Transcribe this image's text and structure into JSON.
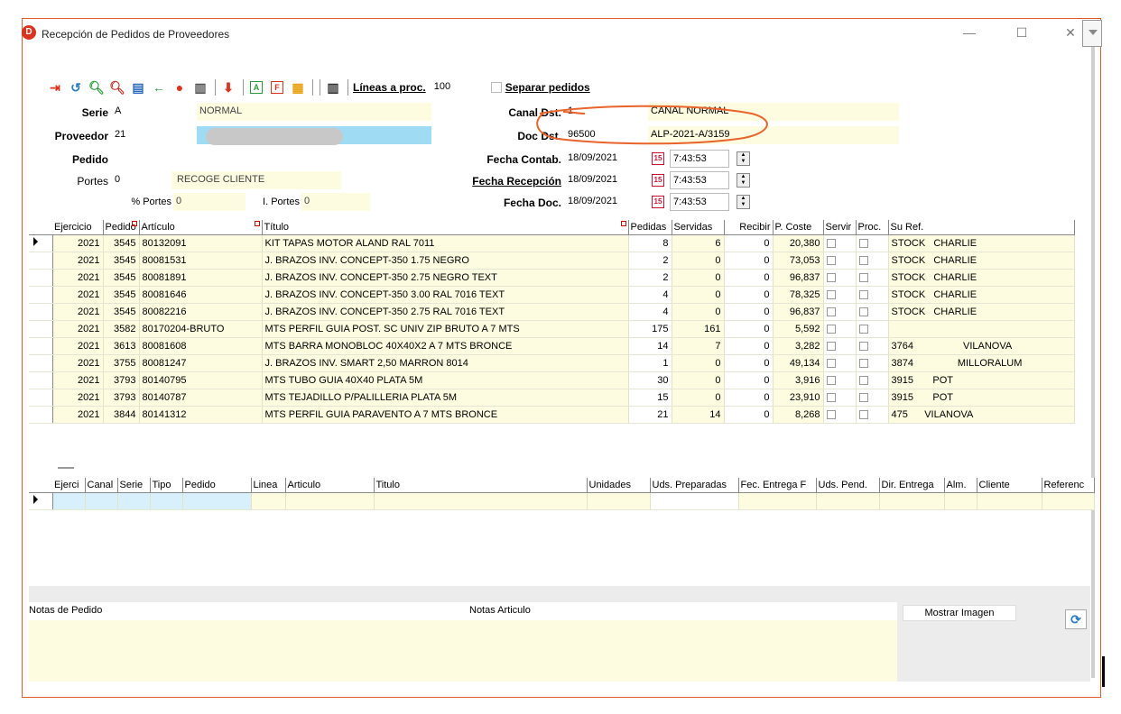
{
  "window": {
    "title": "Recepción de Pedidos de Proveedores",
    "icon_letter": "D",
    "controls": [
      "—",
      "☐",
      "✕"
    ]
  },
  "toolbar": {
    "icons": [
      "exit-icon",
      "undo-icon",
      "search-icon",
      "search-alt-icon",
      "grid-icon",
      "back-arrow-icon",
      "alert-icon",
      "clipboard-icon",
      "download-icon",
      "a-box-icon",
      "f-box-icon",
      "table-icon",
      "columns-icon"
    ],
    "lineas_label": "Líneas a proc.",
    "lineas_value": "100",
    "separar_label": "Separar pedidos"
  },
  "header_fields": {
    "serie_label": "Serie",
    "serie_value": "A",
    "serie_desc": "NORMAL",
    "proveedor_label": "Proveedor",
    "proveedor_value": "21",
    "pedido_label": "Pedido",
    "pedido_value": "",
    "portes_label": "Portes",
    "portes_value": "0",
    "portes_desc": "RECOGE CLIENTE",
    "pct_portes_label": "% Portes",
    "pct_portes_value": "0",
    "i_portes_label": "I. Portes",
    "i_portes_value": "0",
    "canal_label": "Canal Dst.",
    "canal_value": "1",
    "canal_desc": "CANAL NORMAL",
    "doc_label": "Doc Dst.",
    "doc_value": "96500",
    "doc_desc": "ALP-2021-A/3159",
    "fecha_contab_label": "Fecha Contab.",
    "fecha_contab_date": "18/09/2021",
    "fecha_contab_time": "7:43:53",
    "fecha_recep_label": "Fecha Recepción",
    "fecha_recep_date": "18/09/2021",
    "fecha_recep_time": "7:43:53",
    "fecha_doc_label": "Fecha Doc.",
    "fecha_doc_date": "18/09/2021",
    "fecha_doc_time": "7:43:53",
    "cal_glyph": "15"
  },
  "lines_table": {
    "columns": [
      "Ejercicio",
      "Pedido",
      "Artículo",
      "Título",
      "Pedidas",
      "Servidas",
      "Recibir",
      "P. Coste",
      "Servir",
      "Proc.",
      "Su Ref."
    ],
    "rows": [
      [
        "2021",
        "3545",
        "80132091",
        "KIT TAPAS MOTOR ALAND RAL 7011",
        "8",
        "6",
        "0",
        "20,380",
        "STOCK   CHARLIE"
      ],
      [
        "2021",
        "3545",
        "80081531",
        "J. BRAZOS INV. CONCEPT-350 1.75 NEGRO",
        "2",
        "0",
        "0",
        "73,053",
        "STOCK   CHARLIE"
      ],
      [
        "2021",
        "3545",
        "80081891",
        "J. BRAZOS INV. CONCEPT-350 2.75 NEGRO TEXT",
        "2",
        "0",
        "0",
        "96,837",
        "STOCK   CHARLIE"
      ],
      [
        "2021",
        "3545",
        "80081646",
        "J. BRAZOS INV. CONCEPT-350 3.00 RAL 7016 TEXT",
        "4",
        "0",
        "0",
        "78,325",
        "STOCK   CHARLIE"
      ],
      [
        "2021",
        "3545",
        "80082216",
        "J. BRAZOS INV. CONCEPT-350 2.75 RAL 7016 TEXT",
        "4",
        "0",
        "0",
        "96,837",
        "STOCK   CHARLIE"
      ],
      [
        "2021",
        "3582",
        "80170204-BRUTO",
        "MTS PERFIL GUIA POST. SC UNIV ZIP BRUTO A 7 MTS",
        "175",
        "161",
        "0",
        "5,592",
        ""
      ],
      [
        "2021",
        "3613",
        "80081608",
        "MTS BARRA MONOBLOC 40X40X2 A 7 MTS BRONCE",
        "14",
        "7",
        "0",
        "3,282",
        "3764                  VILANOVA"
      ],
      [
        "2021",
        "3755",
        "80081247",
        "J. BRAZOS INV. SMART 2,50 MARRON 8014",
        "1",
        "0",
        "0",
        "49,134",
        "3874                MILLORALUM"
      ],
      [
        "2021",
        "3793",
        "80140795",
        "MTS TUBO GUIA 40X40 PLATA 5M",
        "30",
        "0",
        "0",
        "3,916",
        "3915       POT"
      ],
      [
        "2021",
        "3793",
        "80140787",
        "MTS TEJADILLO P/PALILLERIA PLATA 5M",
        "15",
        "0",
        "0",
        "23,910",
        "3915       POT"
      ],
      [
        "2021",
        "3844",
        "80141312",
        "MTS PERFIL GUIA PARAVENTO A 7 MTS BRONCE",
        "21",
        "14",
        "0",
        "8,268",
        "475      VILANOVA"
      ]
    ]
  },
  "detail_table": {
    "columns": [
      "Ejerci",
      "Canal",
      "Serie",
      "Tipo",
      "Pedido",
      "Linea",
      "Articulo",
      "Titulo",
      "Unidades",
      "Uds. Preparadas",
      "Fec. Entrega F",
      "Uds. Pend.",
      "Dir. Entrega",
      "Alm.",
      "Cliente",
      "Referenc"
    ]
  },
  "notes": {
    "pedido_label": "Notas de Pedido",
    "articulo_label": "Notas Articulo",
    "mostrar_imagen": "Mostrar Imagen"
  },
  "colors": {
    "frame": "#e25b2b",
    "field_yellow": "#fdfbe0",
    "field_blue": "#9fdcf4",
    "annotation": "#e8642c"
  }
}
